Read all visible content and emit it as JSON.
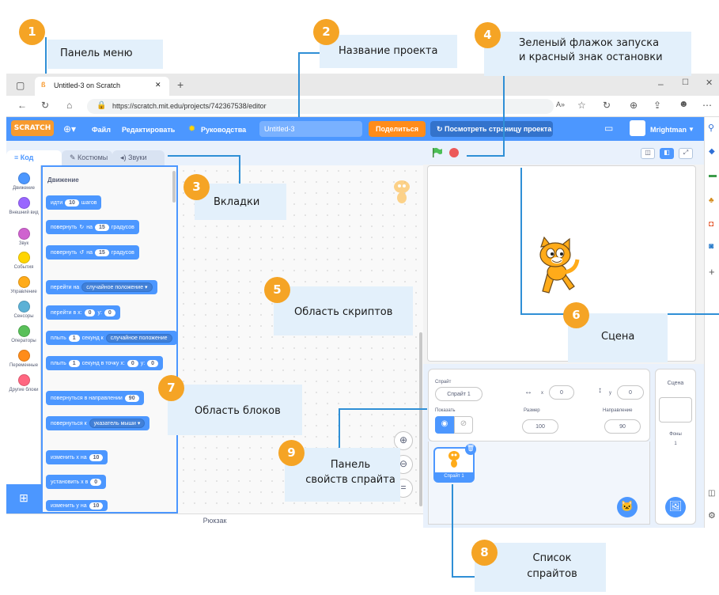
{
  "browser": {
    "tab_title": "Untitled-3 on Scratch",
    "url": "https://scratch.mit.edu/projects/742367538/editor",
    "new_tab": "+",
    "window_controls": [
      "–",
      "☐",
      "✕"
    ]
  },
  "menubar": {
    "logo": "SCRATCH",
    "file": "Файл",
    "edit": "Редактировать",
    "tutorials": "Руководства",
    "project_title": "Untitled-3",
    "share": "Поделиться",
    "see_project_page": "Посмотреть страницу проекта",
    "username": "Mrightman"
  },
  "tabs": {
    "code": "Код",
    "costumes": "Костюмы",
    "sounds": "Звуки"
  },
  "categories": [
    {
      "label": "Движение",
      "color": "#4c97ff"
    },
    {
      "label": "Внешний вид",
      "color": "#9966ff"
    },
    {
      "label": "Звук",
      "color": "#cf63cf"
    },
    {
      "label": "События",
      "color": "#ffd500"
    },
    {
      "label": "Управление",
      "color": "#ffab19"
    },
    {
      "label": "Сенсоры",
      "color": "#5cb1d6"
    },
    {
      "label": "Операторы",
      "color": "#59c059"
    },
    {
      "label": "Переменные",
      "color": "#ff8c1a"
    },
    {
      "label": "Другие блоки",
      "color": "#ff6680"
    }
  ],
  "palette": {
    "heading": "Движение",
    "b_move": {
      "pre": "идти",
      "val": "10",
      "post": "шагов"
    },
    "b_turn_r": {
      "pre": "повернуть",
      "icon": "↻",
      "mid": "на",
      "val": "15",
      "post": "градусов"
    },
    "b_turn_l": {
      "pre": "повернуть",
      "icon": "↺",
      "mid": "на",
      "val": "15",
      "post": "градусов"
    },
    "b_goto": {
      "pre": "перейти на",
      "drop": "случайное положение"
    },
    "b_gotoxy": {
      "pre": "перейти в x:",
      "x": "0",
      "mid": "y:",
      "y": "0"
    },
    "b_glide": {
      "pre": "плыть",
      "val": "1",
      "mid": "секунд к",
      "drop": "случайное положение"
    },
    "b_glidexy": {
      "pre": "плыть",
      "val": "1",
      "mid": "секунд в точку x:",
      "x": "0",
      "ylab": "y:",
      "y": "0"
    },
    "b_point": {
      "pre": "повернуться в направлении",
      "val": "90"
    },
    "b_pointto": {
      "pre": "повернуться к",
      "drop": "указатель мыши"
    },
    "b_changex": {
      "pre": "изменить х на",
      "val": "10"
    },
    "b_setx": {
      "pre": "установить х в",
      "val": "0"
    },
    "b_changey": {
      "pre": "изменить у на",
      "val": "10"
    }
  },
  "backpack": "Рюкзак",
  "sprite_info": {
    "sprite_label": "Спрайт",
    "sprite_name": "Спрайт 1",
    "x_label": "x",
    "x_value": "0",
    "y_label": "y",
    "y_value": "0",
    "show_label": "Показать",
    "size_label": "Размер",
    "size_value": "100",
    "direction_label": "Направление",
    "direction_value": "90"
  },
  "sprite_list": {
    "thumb_label": "Спрайт 1"
  },
  "stage_panel": {
    "title": "Сцена",
    "backdrops_label": "Фоны",
    "backdrops_count": "1"
  },
  "annotations": {
    "a1": {
      "num": "1",
      "text": "Панель меню"
    },
    "a2": {
      "num": "2",
      "text": "Название проекта"
    },
    "a3": {
      "num": "3",
      "text": "Вкладки"
    },
    "a4": {
      "num": "4",
      "line1": "Зеленый флажок запуска",
      "line2": "и красный знак остановки"
    },
    "a5": {
      "num": "5",
      "text": "Область скриптов"
    },
    "a6": {
      "num": "6",
      "text": "Сцена"
    },
    "a7": {
      "num": "7",
      "text": "Область блоков"
    },
    "a8": {
      "num": "8",
      "line1": "Список",
      "line2": "спрайтов"
    },
    "a9": {
      "num": "9",
      "line1": "Панель",
      "line2": "свойств спрайта"
    }
  },
  "colors": {
    "accent": "#4c97ff",
    "callout_bg": "#e3f0fb",
    "number_badge": "#f5a425",
    "share": "#ff8c1a"
  }
}
